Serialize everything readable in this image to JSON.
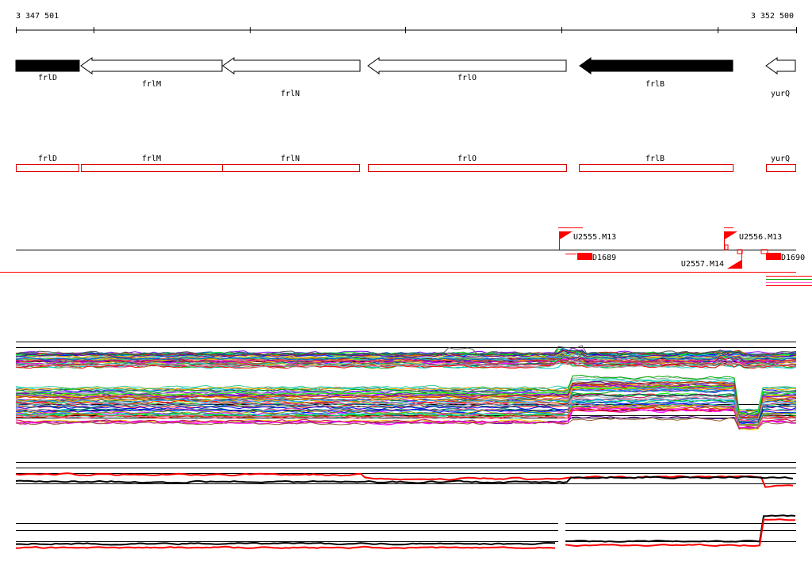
{
  "ruler": {
    "start_label": "3 347 501",
    "end_label": "3 352 500",
    "start": 3347501,
    "end": 3352500
  },
  "colors": {
    "gene_filled": "#000000",
    "gene_outline": "#000000",
    "cds_box": "#dd0000",
    "promoter": "#ff0000",
    "terminator": "#ff0000",
    "baseline": "#000000",
    "divider": "#ff0000",
    "profile_series_1": "#000000",
    "profile_series_2": "#ff0000"
  },
  "genes": [
    {
      "name": "frlD",
      "strand": "-",
      "style": "filled",
      "label": "frlD"
    },
    {
      "name": "frlM",
      "strand": "-",
      "style": "outline",
      "label": "frlM"
    },
    {
      "name": "frlN",
      "strand": "-",
      "style": "outline",
      "label": "frlN"
    },
    {
      "name": "frlO",
      "strand": "-",
      "style": "outline",
      "label": "frlO"
    },
    {
      "name": "frlB",
      "strand": "-",
      "style": "filled",
      "label": "frlB"
    },
    {
      "name": "yurQ",
      "strand": "-",
      "style": "outline",
      "label": "yurQ"
    }
  ],
  "cds_boxes": [
    {
      "label": "frlD"
    },
    {
      "label": "frlM"
    },
    {
      "label": "frlN"
    },
    {
      "label": "frlO"
    },
    {
      "label": "frlB"
    },
    {
      "label": "yurQ"
    }
  ],
  "regulatory": {
    "promoters": [
      {
        "label": "U2555.M13",
        "direction": "forward"
      },
      {
        "label": "U2556.M13",
        "direction": "forward"
      },
      {
        "label": "U2557.M14",
        "direction": "reverse"
      }
    ],
    "terminators": [
      {
        "label": "D1689"
      },
      {
        "label": "D1690"
      }
    ]
  },
  "legend_swatch": {
    "colors": [
      "#ff0000",
      "#00aa00",
      "#ff66cc",
      "#ff0000"
    ]
  },
  "tracks": [
    {
      "name": "expression-track-upper",
      "kind": "multi-condition"
    },
    {
      "name": "expression-track-lower",
      "kind": "multi-condition"
    },
    {
      "name": "strand-profile-plus",
      "kind": "two-series"
    },
    {
      "name": "strand-profile-minus",
      "kind": "two-series"
    }
  ]
}
